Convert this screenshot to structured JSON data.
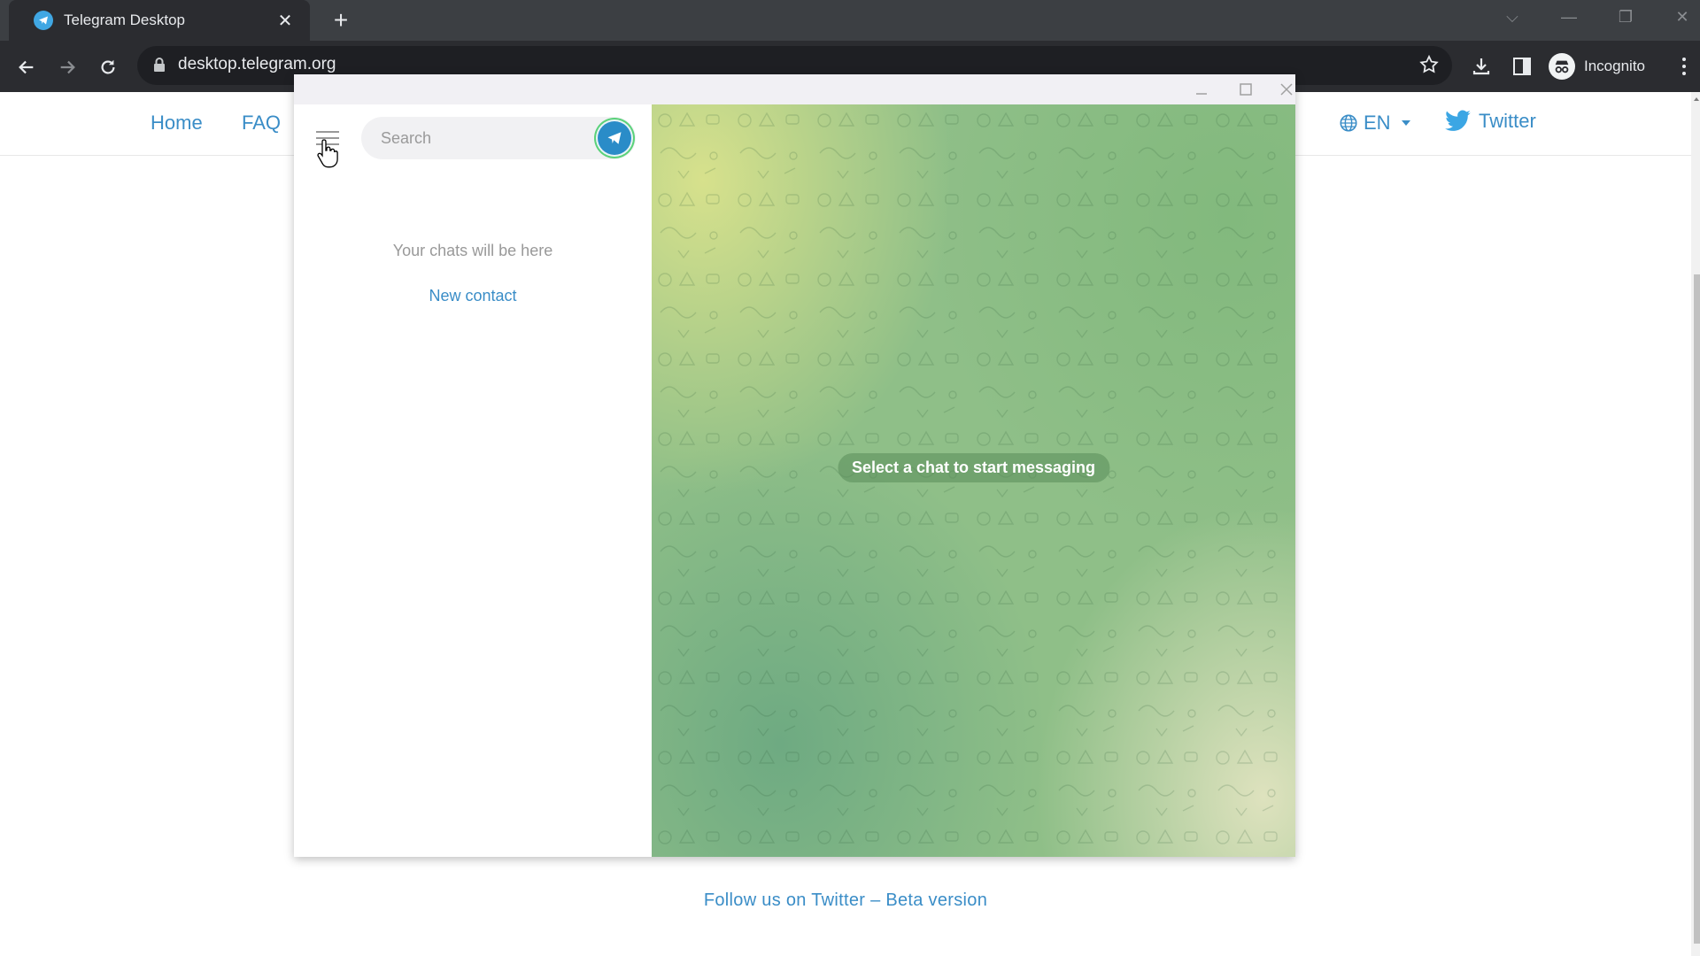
{
  "browser": {
    "tab": {
      "title": "Telegram Desktop",
      "favicon": "telegram-icon",
      "close_icon": "close-icon"
    },
    "new_tab_label": "+",
    "url": "desktop.telegram.org",
    "profile_label": "Incognito",
    "window_controls": [
      "chevron-down-icon",
      "minimize-icon",
      "restore-icon",
      "close-icon"
    ]
  },
  "site": {
    "nav": [
      {
        "label": "Home"
      },
      {
        "label": "FAQ"
      }
    ],
    "language": "EN",
    "twitter_label": "Twitter",
    "footer": "Follow us on Twitter – Beta version",
    "accent_color": "#3a8dc7"
  },
  "telegram": {
    "window_controls": [
      "minimize-icon",
      "maximize-icon",
      "close-icon"
    ],
    "search": {
      "placeholder": "Search",
      "value": ""
    },
    "empty_state": "Your chats will be here",
    "new_contact_label": "New contact",
    "chat_placeholder": "Select a chat to start messaging",
    "brand_color": "#2a8cc8"
  }
}
